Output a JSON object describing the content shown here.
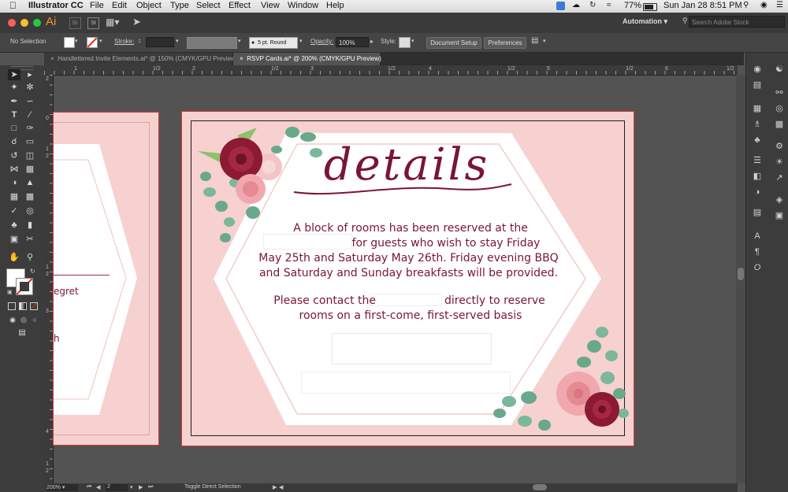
{
  "menubar": {
    "app_name": "Illustrator CC",
    "menus": [
      "File",
      "Edit",
      "Object",
      "Type",
      "Select",
      "Effect",
      "View",
      "Window",
      "Help"
    ],
    "battery": "77%",
    "clock": "Sun Jan 28  8:51 PM"
  },
  "titlebar": {
    "app_badge": "Ai",
    "br_badge": "Br",
    "st_badge": "St",
    "workspace": "Automation",
    "search_placeholder": "Search Adobe Stock"
  },
  "controlbar": {
    "selection": "No Selection",
    "stroke_label": "Stroke:",
    "brush": "5 pt. Round",
    "opacity_label": "Opacity:",
    "opacity_value": "100%",
    "style_label": "Style:",
    "document_setup": "Document Setup",
    "preferences": "Preferences"
  },
  "tabs": [
    {
      "label": "Handlettered Invite Elements.ai* @ 150% (CMYK/GPU Preview)",
      "active": false
    },
    {
      "label": "RSVP Cards.ai* @ 200% (CMYK/GPU Preview)",
      "active": true
    }
  ],
  "rulers": {
    "h_ticks": [
      "1",
      "1/2",
      "2",
      "1/2",
      "3",
      "1/2",
      "4",
      "1/2",
      "5",
      "1/2",
      "6",
      "1/2"
    ],
    "v_ticks": [
      "2",
      "0",
      "1",
      "2",
      "1",
      "2",
      "3",
      "4",
      "1",
      "2"
    ]
  },
  "left_card": {
    "regret_fragment": "egret",
    "h_fragment": "h"
  },
  "card": {
    "script_title": "details",
    "paragraph1": [
      "A block of rooms has been reserved at the",
      "for guests who wish to stay Friday",
      "May 25th and Saturday May 26th.  Friday evening BBQ",
      "and Saturday and Sunday breakfasts will be provided."
    ],
    "paragraph2_a": "Please contact the",
    "paragraph2_b": "directly to reserve",
    "paragraph2_c": "rooms on a first-come, first-served basis"
  },
  "statusbar": {
    "zoom": "200%",
    "artboard": "2",
    "tool_hint": "Toggle Direct Selection"
  },
  "colors": {
    "card_pink": "#f6d1cf",
    "text_maroon": "#7a1535",
    "artboard_border": "#d33b3b",
    "rose_dark": "#8c1a33",
    "rose_light": "#f0a8ae",
    "leaf_green": "#6aa88c"
  }
}
